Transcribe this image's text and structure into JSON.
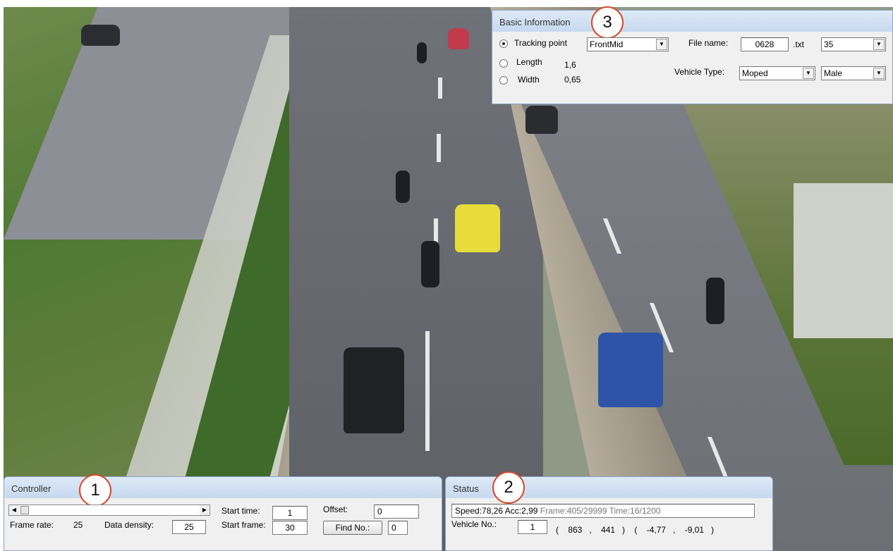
{
  "basic_info": {
    "title": "Basic Information",
    "badge": "3",
    "tracking_point_label": "Tracking point",
    "tracking_point_value": "FrontMid",
    "length_label": "Length",
    "length_value": "1,6",
    "width_label": "Width",
    "width_value": "0,65",
    "file_name_label": "File name:",
    "file_name_value": "0628",
    "file_ext": ".txt",
    "file_number": "35",
    "vehicle_type_label": "Vehicle Type:",
    "vehicle_type_value": "Moped",
    "gender_value": "Male"
  },
  "controller": {
    "title": "Controller",
    "badge": "1",
    "frame_rate_label": "Frame rate:",
    "frame_rate_value": "25",
    "data_density_label": "Data density:",
    "data_density_value": "25",
    "start_time_label": "Start time:",
    "start_time_value": "1",
    "start_frame_label": "Start frame:",
    "start_frame_value": "30",
    "offset_label": "Offset:",
    "offset_value": "0",
    "find_button": "Find No.:",
    "find_value": "0",
    "scroll_left": "◀",
    "scroll_right": "▶"
  },
  "status": {
    "title": "Status",
    "badge": "2",
    "speed_acc": "Speed:78,26 Acc:2,99",
    "frame_time": "Frame:405/29999 Time:16/1200",
    "vehicle_no_label": "Vehicle No.:",
    "vehicle_no_value": "1",
    "coords": "(    863   ,    441   )    (    -4,77   ,    -9,01   )"
  },
  "icons": {
    "dropdown": "▼"
  }
}
